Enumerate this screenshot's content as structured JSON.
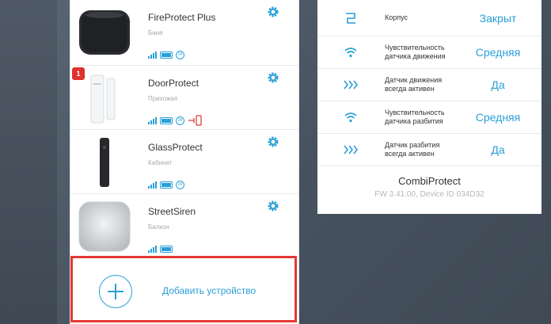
{
  "devices": [
    {
      "name": "FireProtect Plus",
      "room": "Баня",
      "mode_badge": "24",
      "alert": ""
    },
    {
      "name": "DoorProtect",
      "room": "Прихожая",
      "mode_badge": "24",
      "alert": "1"
    },
    {
      "name": "GlassProtect",
      "room": "Кабинет",
      "mode_badge": "24",
      "alert": ""
    },
    {
      "name": "StreetSiren",
      "room": "Балкон",
      "mode_badge": "",
      "alert": ""
    }
  ],
  "add_device": {
    "label": "Добавить устройство"
  },
  "settings": [
    {
      "icon": "lid-icon",
      "label": "Корпус",
      "value": "Закрыт"
    },
    {
      "icon": "wireless-icon",
      "label": "Чувствительность датчика движения",
      "value": "Средняя"
    },
    {
      "icon": "chevrons-icon",
      "label": "Датчик движения всегда активен",
      "value": "Да"
    },
    {
      "icon": "wireless-icon",
      "label": "Чувствительность датчика разбития",
      "value": "Средняя"
    },
    {
      "icon": "chevrons-icon",
      "label": "Датчик разбития всегда активен",
      "value": "Да"
    }
  ],
  "device_info": {
    "name": "CombiProtect",
    "firmware": "FW 3.41.00, Device ID 034D32"
  },
  "colors": {
    "accent": "#2a9fd8",
    "alert": "#e0302e",
    "highlight_border": "#e53935"
  }
}
